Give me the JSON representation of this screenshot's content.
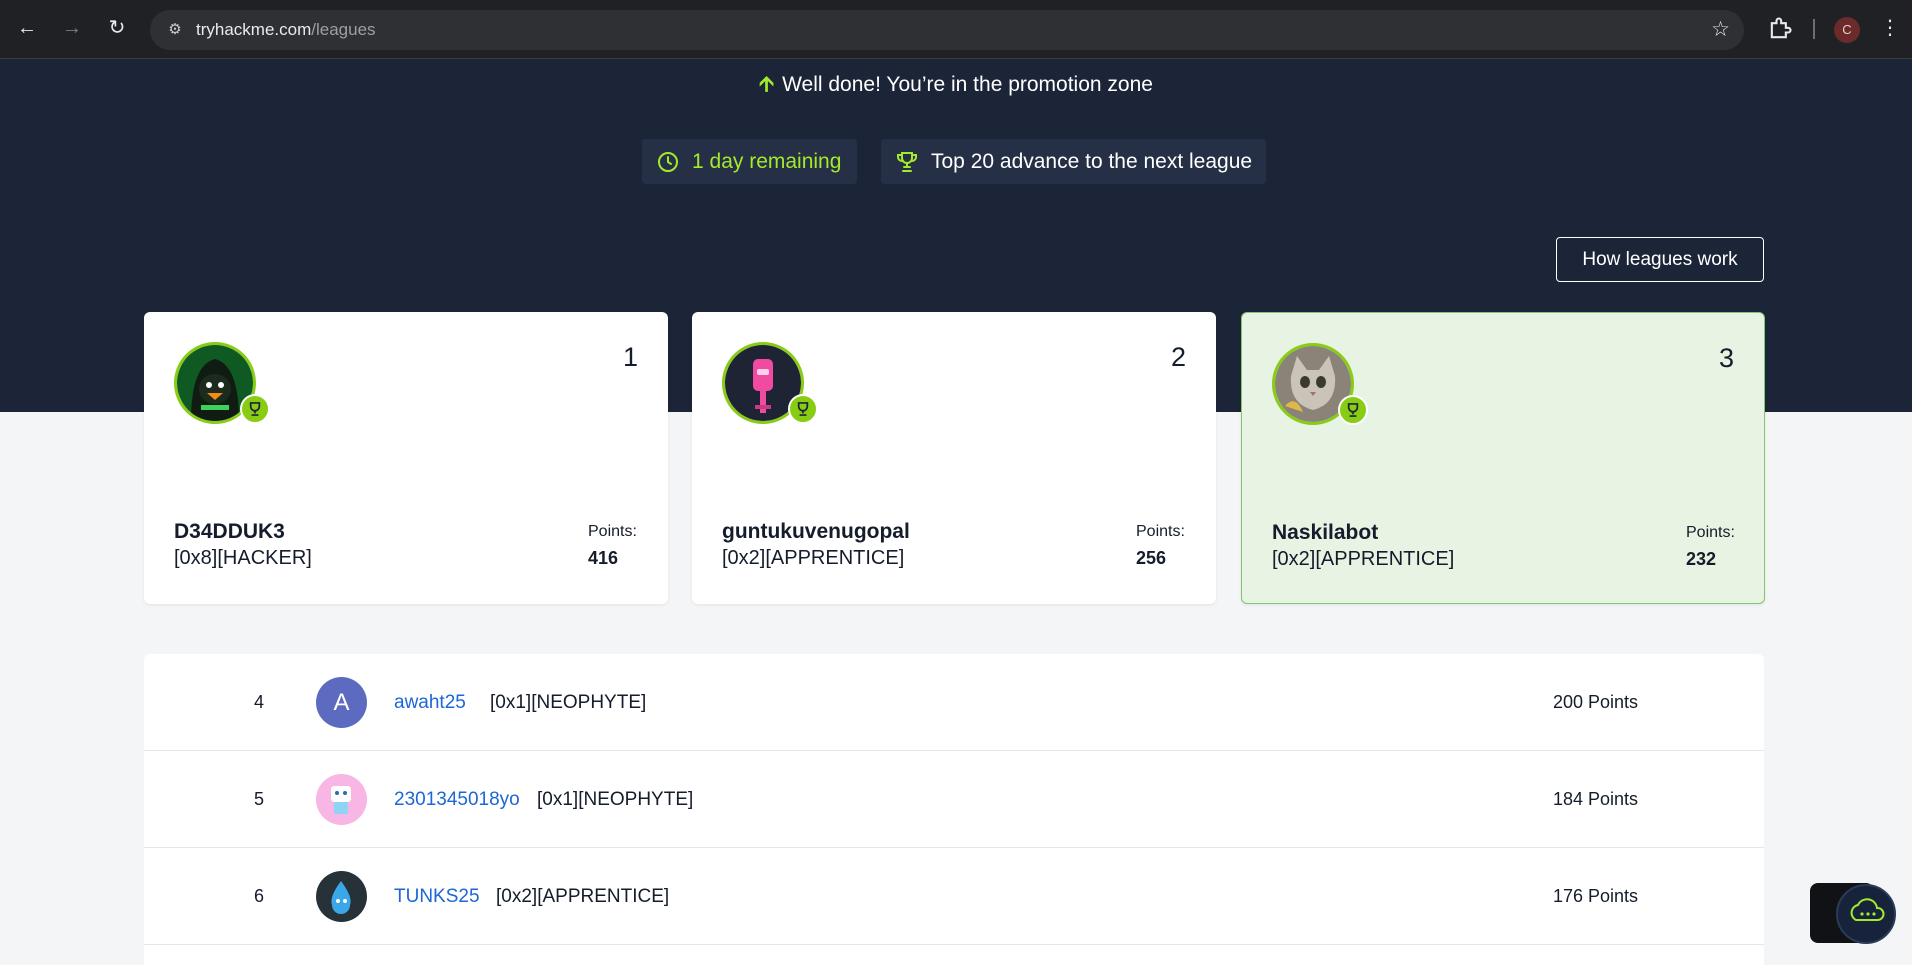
{
  "browser": {
    "url_host": "tryhackme.com",
    "url_path": "/leagues",
    "profile_initial": "C"
  },
  "hero": {
    "promotion_message": "Well done! You’re in the promotion zone",
    "time_remaining": "1 day remaining",
    "advance_info": "Top 20 advance to the next league",
    "how_leagues_work_label": "How leagues work"
  },
  "colors": {
    "accent_green": "#a3ea2a",
    "hero_bg": "#1c2538",
    "link_blue": "#1c66d6"
  },
  "podium": [
    {
      "rank": "1",
      "username": "D34DDUK3",
      "title": "[0x8][HACKER]",
      "points_label": "Points:",
      "points": "416",
      "avatar": "hooded-duck-avatar"
    },
    {
      "rank": "2",
      "username": "guntukuvenugopal",
      "title": "[0x2][APPRENTICE]",
      "points_label": "Points:",
      "points": "256",
      "avatar": "pink-robot-avatar"
    },
    {
      "rank": "3",
      "username": "Naskilabot",
      "title": "[0x2][APPRENTICE]",
      "points_label": "Points:",
      "points": "232",
      "avatar": "cat-avatar"
    }
  ],
  "leaderboard": [
    {
      "rank": "4",
      "username": "awaht25",
      "title": "[0x1][NEOPHYTE]",
      "points": "200 Points",
      "avatar_letter": "A"
    },
    {
      "rank": "5",
      "username": "2301345018yo",
      "title": "[0x1][NEOPHYTE]",
      "points": "184 Points",
      "avatar_letter": ""
    },
    {
      "rank": "6",
      "username": "TUNKS25",
      "title": "[0x2][APPRENTICE]",
      "points": "176 Points",
      "avatar_letter": ""
    }
  ]
}
